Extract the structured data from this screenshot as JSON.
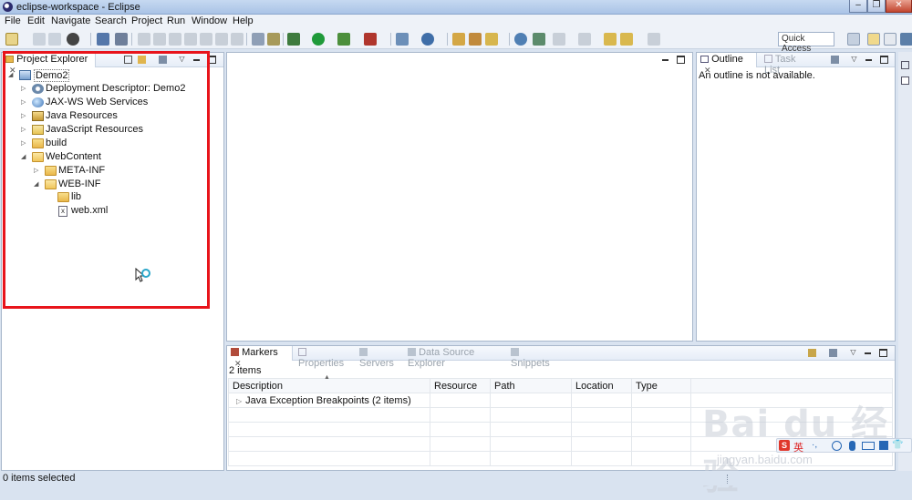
{
  "window": {
    "title": "eclipse-workspace - Eclipse"
  },
  "menu": [
    "File",
    "Edit",
    "Navigate",
    "Search",
    "Project",
    "Run",
    "Window",
    "Help"
  ],
  "toolbar": {
    "quick_access": "Quick Access"
  },
  "project_explorer": {
    "tab_label": "Project Explorer",
    "tree": [
      {
        "label": "Demo2",
        "icon": "project-icon"
      },
      {
        "label": "Deployment Descriptor: Demo2",
        "icon": "deployment-descriptor-icon"
      },
      {
        "label": "JAX-WS Web Services",
        "icon": "web-services-icon"
      },
      {
        "label": "Java Resources",
        "icon": "java-resources-icon"
      },
      {
        "label": "JavaScript Resources",
        "icon": "javascript-resources-icon"
      },
      {
        "label": "build",
        "icon": "folder-icon"
      },
      {
        "label": "WebContent",
        "icon": "folder-open-icon"
      },
      {
        "label": "META-INF",
        "icon": "folder-icon"
      },
      {
        "label": "WEB-INF",
        "icon": "folder-open-icon"
      },
      {
        "label": "lib",
        "icon": "folder-icon"
      },
      {
        "label": "web.xml",
        "icon": "xml-file-icon"
      }
    ],
    "highlight_color": "#e8141b"
  },
  "outline": {
    "tabs": [
      "Outline",
      "Task List"
    ],
    "message": "An outline is not available."
  },
  "markers": {
    "tabs": [
      "Markers",
      "Properties",
      "Servers",
      "Data Source Explorer",
      "Snippets"
    ],
    "count": "2 items",
    "columns": [
      "Description",
      "Resource",
      "Path",
      "Location",
      "Type"
    ],
    "rows": [
      {
        "description": "Java Exception Breakpoints (2 items)"
      }
    ]
  },
  "status": {
    "left": "0 items selected"
  },
  "watermark": {
    "brand": "Bai du 经验",
    "url": "jingyan.baidu.com",
    "ime_label": "英"
  }
}
